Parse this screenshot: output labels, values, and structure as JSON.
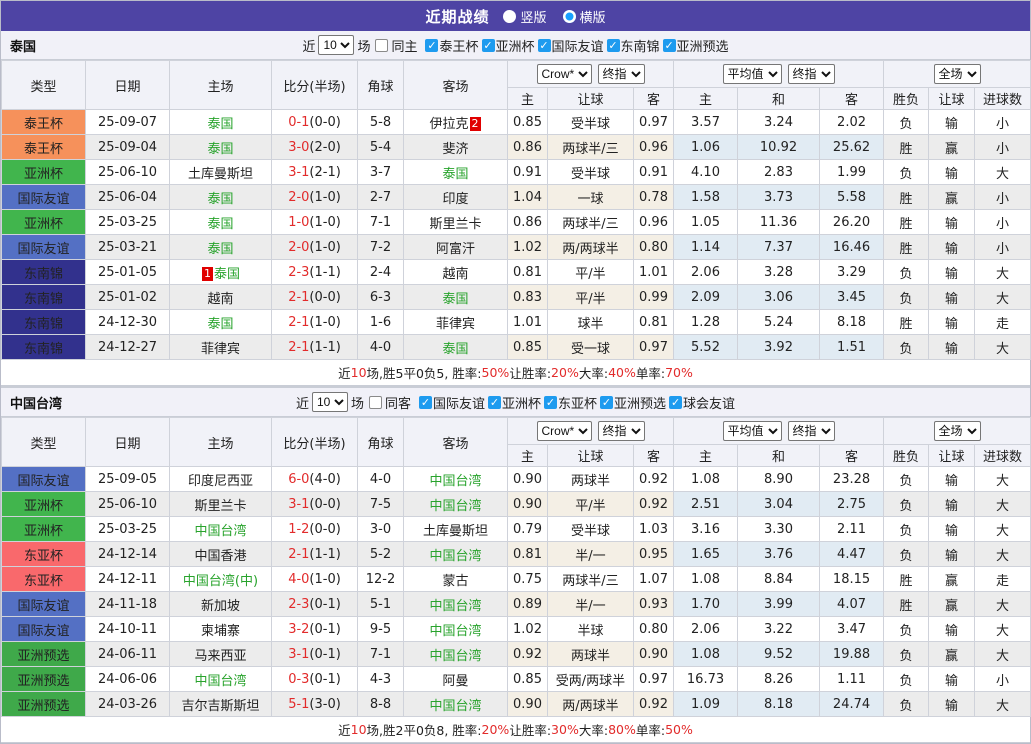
{
  "colors": {
    "titlebar_purple": "#4e44a4",
    "checkbox_blue": "#1e9bef",
    "score_red": "#e22b2b",
    "team_green": "#28a32c",
    "result_blue": "#3643c8",
    "result_green": "#1e9e30",
    "type_thai_king_cup": "#f6915b",
    "type_asian_cup": "#41b54d",
    "type_intl_friendly": "#5470c4",
    "type_sea_champ": "#32318d",
    "type_east_asian_cup": "#f9696c",
    "type_asian_qualifier": "#3fa94a"
  },
  "title_bar": {
    "title": "近期战绩",
    "radios": [
      {
        "label": "竖版",
        "selected": false
      },
      {
        "label": "横版",
        "selected": true
      }
    ]
  },
  "table_header": {
    "base_cols": [
      "类型",
      "日期",
      "主场",
      "比分(半场)",
      "角球",
      "客场"
    ],
    "odds_select": "Crow*",
    "odds_final": "终指",
    "odds_sub": [
      "主",
      "让球",
      "客"
    ],
    "avg_select": "平均值",
    "avg_final": "终指",
    "avg_sub": [
      "主",
      "和",
      "客"
    ],
    "scope_select": "全场",
    "result_sub": [
      "胜负",
      "让球",
      "进球数"
    ]
  },
  "sections": [
    {
      "name": "泰国",
      "filter": {
        "near_label": "近",
        "count_value": "10",
        "games_label": "场",
        "same_label": "同主",
        "same_checked": false,
        "leagues": [
          "泰王杯",
          "亚洲杯",
          "国际友谊",
          "东南锦",
          "亚洲预选"
        ]
      },
      "rows": [
        {
          "type": "泰王杯",
          "type_class": "orange",
          "date": "25-09-07",
          "home": {
            "text": "泰国",
            "green": true
          },
          "away": {
            "text": "伊拉克",
            "green": false,
            "badge": "2",
            "badge_pos": "after"
          },
          "score_full": "0-1",
          "score_half": "(0-0)",
          "corner": "5-8",
          "odds": [
            "0.85",
            "受半球",
            "0.97"
          ],
          "avg": [
            "3.57",
            "3.24",
            "2.02"
          ],
          "res": [
            {
              "t": "负",
              "c": "blue"
            },
            {
              "t": "输",
              "c": "blue"
            },
            {
              "t": "小",
              "c": "blue"
            }
          ]
        },
        {
          "type": "泰王杯",
          "type_class": "orange",
          "date": "25-09-04",
          "home": {
            "text": "泰国",
            "green": true
          },
          "away": {
            "text": "斐济",
            "green": false
          },
          "score_full": "3-0",
          "score_half": "(2-0)",
          "corner": "5-4",
          "odds": [
            "0.86",
            "两球半/三",
            "0.96"
          ],
          "avg": [
            "1.06",
            "10.92",
            "25.62"
          ],
          "res": [
            {
              "t": "胜",
              "c": "red"
            },
            {
              "t": "赢",
              "c": "red"
            },
            {
              "t": "小",
              "c": "blue"
            }
          ]
        },
        {
          "type": "亚洲杯",
          "type_class": "green",
          "date": "25-06-10",
          "home": {
            "text": "土库曼斯坦",
            "green": false
          },
          "away": {
            "text": "泰国",
            "green": true
          },
          "score_full": "3-1",
          "score_half": "(2-1)",
          "corner": "3-7",
          "odds": [
            "0.91",
            "受半球",
            "0.91"
          ],
          "avg": [
            "4.10",
            "2.83",
            "1.99"
          ],
          "res": [
            {
              "t": "负",
              "c": "blue"
            },
            {
              "t": "输",
              "c": "blue"
            },
            {
              "t": "大",
              "c": "red"
            }
          ]
        },
        {
          "type": "国际友谊",
          "type_class": "blue",
          "date": "25-06-04",
          "home": {
            "text": "泰国",
            "green": true
          },
          "away": {
            "text": "印度",
            "green": false
          },
          "score_full": "2-0",
          "score_half": "(1-0)",
          "corner": "2-7",
          "odds": [
            "1.04",
            "一球",
            "0.78"
          ],
          "avg": [
            "1.58",
            "3.73",
            "5.58"
          ],
          "res": [
            {
              "t": "胜",
              "c": "red"
            },
            {
              "t": "赢",
              "c": "red"
            },
            {
              "t": "小",
              "c": "blue"
            }
          ]
        },
        {
          "type": "亚洲杯",
          "type_class": "green",
          "date": "25-03-25",
          "home": {
            "text": "泰国",
            "green": true
          },
          "away": {
            "text": "斯里兰卡",
            "green": false
          },
          "score_full": "1-0",
          "score_half": "(1-0)",
          "corner": "7-1",
          "odds": [
            "0.86",
            "两球半/三",
            "0.96"
          ],
          "avg": [
            "1.05",
            "11.36",
            "26.20"
          ],
          "res": [
            {
              "t": "胜",
              "c": "red"
            },
            {
              "t": "输",
              "c": "blue"
            },
            {
              "t": "小",
              "c": "blue"
            }
          ]
        },
        {
          "type": "国际友谊",
          "type_class": "blue",
          "date": "25-03-21",
          "home": {
            "text": "泰国",
            "green": true
          },
          "away": {
            "text": "阿富汗",
            "green": false
          },
          "score_full": "2-0",
          "score_half": "(1-0)",
          "corner": "7-2",
          "odds": [
            "1.02",
            "两/两球半",
            "0.80"
          ],
          "avg": [
            "1.14",
            "7.37",
            "16.46"
          ],
          "res": [
            {
              "t": "胜",
              "c": "red"
            },
            {
              "t": "输",
              "c": "blue"
            },
            {
              "t": "小",
              "c": "blue"
            }
          ]
        },
        {
          "type": "东南锦",
          "type_class": "navy",
          "date": "25-01-05",
          "home": {
            "text": "泰国",
            "green": true,
            "badge": "1",
            "badge_pos": "before"
          },
          "away": {
            "text": "越南",
            "green": false
          },
          "score_full": "2-3",
          "score_half": "(1-1)",
          "corner": "2-4",
          "odds": [
            "0.81",
            "平/半",
            "1.01"
          ],
          "avg": [
            "2.06",
            "3.28",
            "3.29"
          ],
          "res": [
            {
              "t": "负",
              "c": "blue"
            },
            {
              "t": "输",
              "c": "blue"
            },
            {
              "t": "大",
              "c": "red"
            }
          ]
        },
        {
          "type": "东南锦",
          "type_class": "navy",
          "date": "25-01-02",
          "home": {
            "text": "越南",
            "green": false
          },
          "away": {
            "text": "泰国",
            "green": true
          },
          "score_full": "2-1",
          "score_half": "(0-0)",
          "corner": "6-3",
          "odds": [
            "0.83",
            "平/半",
            "0.99"
          ],
          "avg": [
            "2.09",
            "3.06",
            "3.45"
          ],
          "res": [
            {
              "t": "负",
              "c": "blue"
            },
            {
              "t": "输",
              "c": "blue"
            },
            {
              "t": "大",
              "c": "red"
            }
          ]
        },
        {
          "type": "东南锦",
          "type_class": "navy",
          "date": "24-12-30",
          "home": {
            "text": "泰国",
            "green": true
          },
          "away": {
            "text": "菲律宾",
            "green": false
          },
          "score_full": "2-1",
          "score_half": "(1-0)",
          "corner": "1-6",
          "odds": [
            "1.01",
            "球半",
            "0.81"
          ],
          "avg": [
            "1.28",
            "5.24",
            "8.18"
          ],
          "res": [
            {
              "t": "胜",
              "c": "red"
            },
            {
              "t": "输",
              "c": "blue"
            },
            {
              "t": "走",
              "c": "green"
            }
          ]
        },
        {
          "type": "东南锦",
          "type_class": "navy",
          "date": "24-12-27",
          "home": {
            "text": "菲律宾",
            "green": false
          },
          "away": {
            "text": "泰国",
            "green": true
          },
          "score_full": "2-1",
          "score_half": "(1-1)",
          "corner": "4-0",
          "odds": [
            "0.85",
            "受一球",
            "0.97"
          ],
          "avg": [
            "5.52",
            "3.92",
            "1.51"
          ],
          "res": [
            {
              "t": "负",
              "c": "blue"
            },
            {
              "t": "输",
              "c": "blue"
            },
            {
              "t": "大",
              "c": "red"
            }
          ]
        }
      ],
      "summary": [
        {
          "t": "近",
          "c": "dark"
        },
        {
          "t": "10",
          "c": "red"
        },
        {
          "t": "场,胜5平0负5, 胜率:",
          "c": "dark"
        },
        {
          "t": "50%",
          "c": "red"
        },
        {
          "t": " 让胜率:",
          "c": "dark"
        },
        {
          "t": "20%",
          "c": "red"
        },
        {
          "t": " 大率:",
          "c": "dark"
        },
        {
          "t": "40%",
          "c": "red"
        },
        {
          "t": " 单率:",
          "c": "dark"
        },
        {
          "t": "70%",
          "c": "red"
        }
      ]
    },
    {
      "name": "中国台湾",
      "filter": {
        "near_label": "近",
        "count_value": "10",
        "games_label": "场",
        "same_label": "同客",
        "same_checked": false,
        "leagues": [
          "国际友谊",
          "亚洲杯",
          "东亚杯",
          "亚洲预选",
          "球会友谊"
        ]
      },
      "rows": [
        {
          "type": "国际友谊",
          "type_class": "blue",
          "date": "25-09-05",
          "home": {
            "text": "印度尼西亚",
            "green": false
          },
          "away": {
            "text": "中国台湾",
            "green": true
          },
          "score_full": "6-0",
          "score_half": "(4-0)",
          "corner": "4-0",
          "odds": [
            "0.90",
            "两球半",
            "0.92"
          ],
          "avg": [
            "1.08",
            "8.90",
            "23.28"
          ],
          "res": [
            {
              "t": "负",
              "c": "blue"
            },
            {
              "t": "输",
              "c": "blue"
            },
            {
              "t": "大",
              "c": "red"
            }
          ]
        },
        {
          "type": "亚洲杯",
          "type_class": "green",
          "date": "25-06-10",
          "home": {
            "text": "斯里兰卡",
            "green": false
          },
          "away": {
            "text": "中国台湾",
            "green": true
          },
          "score_full": "3-1",
          "score_half": "(0-0)",
          "corner": "7-5",
          "odds": [
            "0.90",
            "平/半",
            "0.92"
          ],
          "avg": [
            "2.51",
            "3.04",
            "2.75"
          ],
          "res": [
            {
              "t": "负",
              "c": "blue"
            },
            {
              "t": "输",
              "c": "blue"
            },
            {
              "t": "大",
              "c": "red"
            }
          ]
        },
        {
          "type": "亚洲杯",
          "type_class": "green",
          "date": "25-03-25",
          "home": {
            "text": "中国台湾",
            "green": true
          },
          "away": {
            "text": "土库曼斯坦",
            "green": false
          },
          "score_full": "1-2",
          "score_half": "(0-0)",
          "corner": "3-0",
          "odds": [
            "0.79",
            "受半球",
            "1.03"
          ],
          "avg": [
            "3.16",
            "3.30",
            "2.11"
          ],
          "res": [
            {
              "t": "负",
              "c": "blue"
            },
            {
              "t": "输",
              "c": "blue"
            },
            {
              "t": "大",
              "c": "red"
            }
          ]
        },
        {
          "type": "东亚杯",
          "type_class": "red",
          "date": "24-12-14",
          "home": {
            "text": "中国香港",
            "green": false
          },
          "away": {
            "text": "中国台湾",
            "green": true
          },
          "score_full": "2-1",
          "score_half": "(1-1)",
          "corner": "5-2",
          "odds": [
            "0.81",
            "半/一",
            "0.95"
          ],
          "avg": [
            "1.65",
            "3.76",
            "4.47"
          ],
          "res": [
            {
              "t": "负",
              "c": "blue"
            },
            {
              "t": "输",
              "c": "blue"
            },
            {
              "t": "大",
              "c": "red"
            }
          ]
        },
        {
          "type": "东亚杯",
          "type_class": "red",
          "date": "24-12-11",
          "home": {
            "text": "中国台湾(中)",
            "green": true
          },
          "away": {
            "text": "蒙古",
            "green": false
          },
          "score_full": "4-0",
          "score_half": "(1-0)",
          "corner": "12-2",
          "odds": [
            "0.75",
            "两球半/三",
            "1.07"
          ],
          "avg": [
            "1.08",
            "8.84",
            "18.15"
          ],
          "res": [
            {
              "t": "胜",
              "c": "red"
            },
            {
              "t": "赢",
              "c": "red"
            },
            {
              "t": "走",
              "c": "green"
            }
          ]
        },
        {
          "type": "国际友谊",
          "type_class": "blue",
          "date": "24-11-18",
          "home": {
            "text": "新加坡",
            "green": false
          },
          "away": {
            "text": "中国台湾",
            "green": true
          },
          "score_full": "2-3",
          "score_half": "(0-1)",
          "corner": "5-1",
          "odds": [
            "0.89",
            "半/一",
            "0.93"
          ],
          "avg": [
            "1.70",
            "3.99",
            "4.07"
          ],
          "res": [
            {
              "t": "胜",
              "c": "red"
            },
            {
              "t": "赢",
              "c": "red"
            },
            {
              "t": "大",
              "c": "red"
            }
          ]
        },
        {
          "type": "国际友谊",
          "type_class": "blue",
          "date": "24-10-11",
          "home": {
            "text": "柬埔寨",
            "green": false
          },
          "away": {
            "text": "中国台湾",
            "green": true
          },
          "score_full": "3-2",
          "score_half": "(0-1)",
          "corner": "9-5",
          "odds": [
            "1.02",
            "半球",
            "0.80"
          ],
          "avg": [
            "2.06",
            "3.22",
            "3.47"
          ],
          "res": [
            {
              "t": "负",
              "c": "blue"
            },
            {
              "t": "输",
              "c": "blue"
            },
            {
              "t": "大",
              "c": "red"
            }
          ]
        },
        {
          "type": "亚洲预选",
          "type_class": "greeny",
          "date": "24-06-11",
          "home": {
            "text": "马来西亚",
            "green": false
          },
          "away": {
            "text": "中国台湾",
            "green": true
          },
          "score_full": "3-1",
          "score_half": "(0-1)",
          "corner": "7-1",
          "odds": [
            "0.92",
            "两球半",
            "0.90"
          ],
          "avg": [
            "1.08",
            "9.52",
            "19.88"
          ],
          "res": [
            {
              "t": "负",
              "c": "blue"
            },
            {
              "t": "赢",
              "c": "red"
            },
            {
              "t": "大",
              "c": "red"
            }
          ]
        },
        {
          "type": "亚洲预选",
          "type_class": "greeny",
          "date": "24-06-06",
          "home": {
            "text": "中国台湾",
            "green": true
          },
          "away": {
            "text": "阿曼",
            "green": false
          },
          "score_full": "0-3",
          "score_half": "(0-1)",
          "corner": "4-3",
          "odds": [
            "0.85",
            "受两/两球半",
            "0.97"
          ],
          "avg": [
            "16.73",
            "8.26",
            "1.11"
          ],
          "res": [
            {
              "t": "负",
              "c": "blue"
            },
            {
              "t": "输",
              "c": "blue"
            },
            {
              "t": "小",
              "c": "blue"
            }
          ]
        },
        {
          "type": "亚洲预选",
          "type_class": "greeny",
          "date": "24-03-26",
          "home": {
            "text": "吉尔吉斯斯坦",
            "green": false
          },
          "away": {
            "text": "中国台湾",
            "green": true
          },
          "score_full": "5-1",
          "score_half": "(3-0)",
          "corner": "8-8",
          "odds": [
            "0.90",
            "两/两球半",
            "0.92"
          ],
          "avg": [
            "1.09",
            "8.18",
            "24.74"
          ],
          "res": [
            {
              "t": "负",
              "c": "blue"
            },
            {
              "t": "输",
              "c": "blue"
            },
            {
              "t": "大",
              "c": "red"
            }
          ]
        }
      ],
      "summary": [
        {
          "t": "近",
          "c": "dark"
        },
        {
          "t": "10",
          "c": "red"
        },
        {
          "t": "场,胜2平0负8, 胜率:",
          "c": "dark"
        },
        {
          "t": "20%",
          "c": "red"
        },
        {
          "t": " 让胜率:",
          "c": "dark"
        },
        {
          "t": "30%",
          "c": "red"
        },
        {
          "t": " 大率:",
          "c": "dark"
        },
        {
          "t": "80%",
          "c": "red"
        },
        {
          "t": " 单率:",
          "c": "dark"
        },
        {
          "t": "50%",
          "c": "red"
        }
      ]
    }
  ]
}
